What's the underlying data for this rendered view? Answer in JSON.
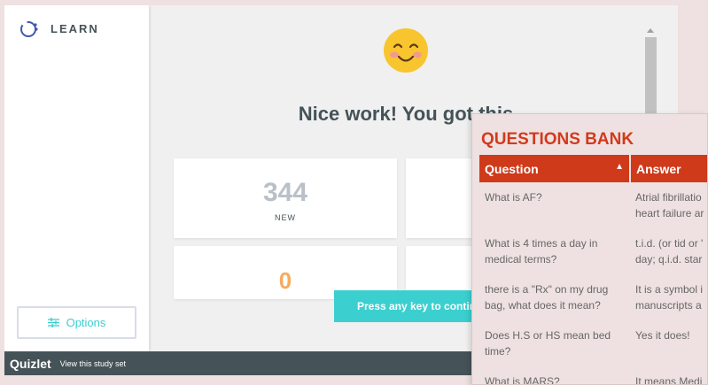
{
  "quizlet": {
    "sidebar": {
      "mode_label": "LEARN",
      "options_label": "Options"
    },
    "headline": "Nice work! You got this",
    "stats": {
      "new_count": "344",
      "new_label": "NEW",
      "other_count": "0"
    },
    "continue_label": "Press any key to continue",
    "footer": {
      "brand": "Quizlet",
      "link": "View this study set"
    },
    "colors": {
      "accent": "#3ccfcf",
      "dark": "#455358",
      "orange": "#f6ab5f"
    }
  },
  "questions_bank": {
    "title": "QUESTIONS BANK",
    "columns": [
      "Question",
      "Answer"
    ],
    "rows": [
      {
        "q": "What is AF?",
        "a1": "Atrial fibrillatio",
        "a2": "heart failure ar"
      },
      {
        "q": "What is 4 times a day in medical terms?",
        "a1": "t.i.d. (or tid or '",
        "a2": "day; q.i.d. star"
      },
      {
        "q": "there is a \"Rx\" on my drug bag, what does it mean?",
        "a1": "It is a symbol i",
        "a2": "manuscripts a"
      },
      {
        "q": "Does H.S or HS mean bed time?",
        "a1": "Yes it does!",
        "a2": ""
      },
      {
        "q": "What is MARS?",
        "a1": "It means Medi",
        "a2": ""
      }
    ],
    "colors": {
      "title": "#d23a1c",
      "header": "#cf3a1a"
    }
  }
}
